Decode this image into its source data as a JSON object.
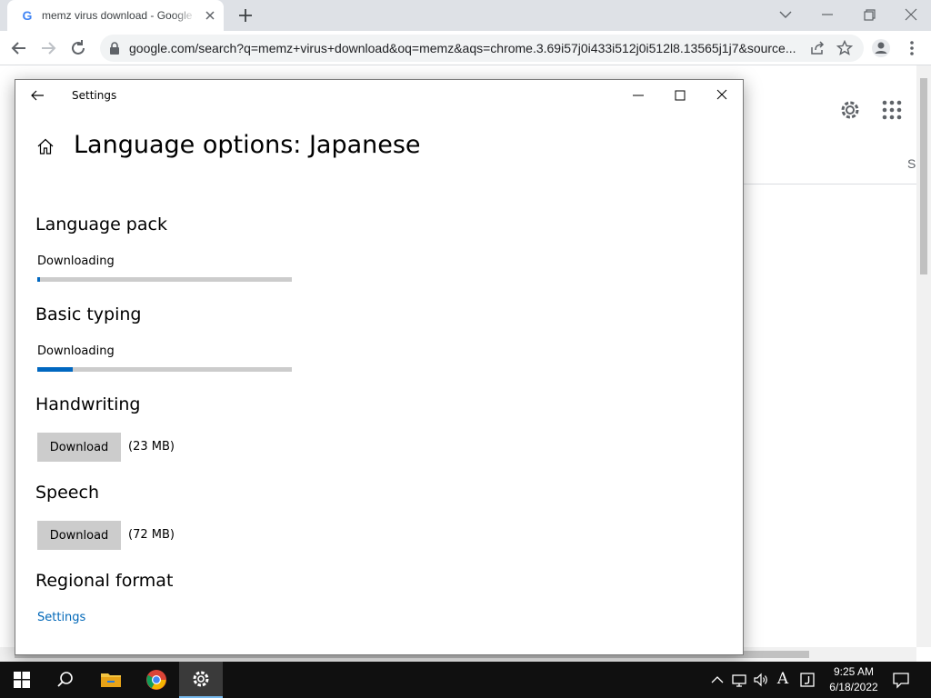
{
  "browser": {
    "tab_title": "memz virus download - Google S",
    "url": "google.com/search?q=memz+virus+download&oq=memz&aqs=chrome.3.69i57j0i433i512j0i512l8.13565j1j7&source..."
  },
  "page": {
    "partial_text": "S"
  },
  "settings": {
    "window_title": "Settings",
    "heading": "Language options: Japanese",
    "language_pack": {
      "title": "Language pack",
      "status": "Downloading",
      "progress": 0.01
    },
    "basic_typing": {
      "title": "Basic typing",
      "status": "Downloading",
      "progress": 0.14
    },
    "handwriting": {
      "title": "Handwriting",
      "button": "Download",
      "size": "(23 MB)"
    },
    "speech": {
      "title": "Speech",
      "button": "Download",
      "size": "(72 MB)"
    },
    "regional_format": {
      "title": "Regional format",
      "link": "Settings"
    }
  },
  "taskbar": {
    "time": "9:25 AM",
    "date": "6/18/2022",
    "ime": "A",
    "accent": "#0067c0"
  }
}
